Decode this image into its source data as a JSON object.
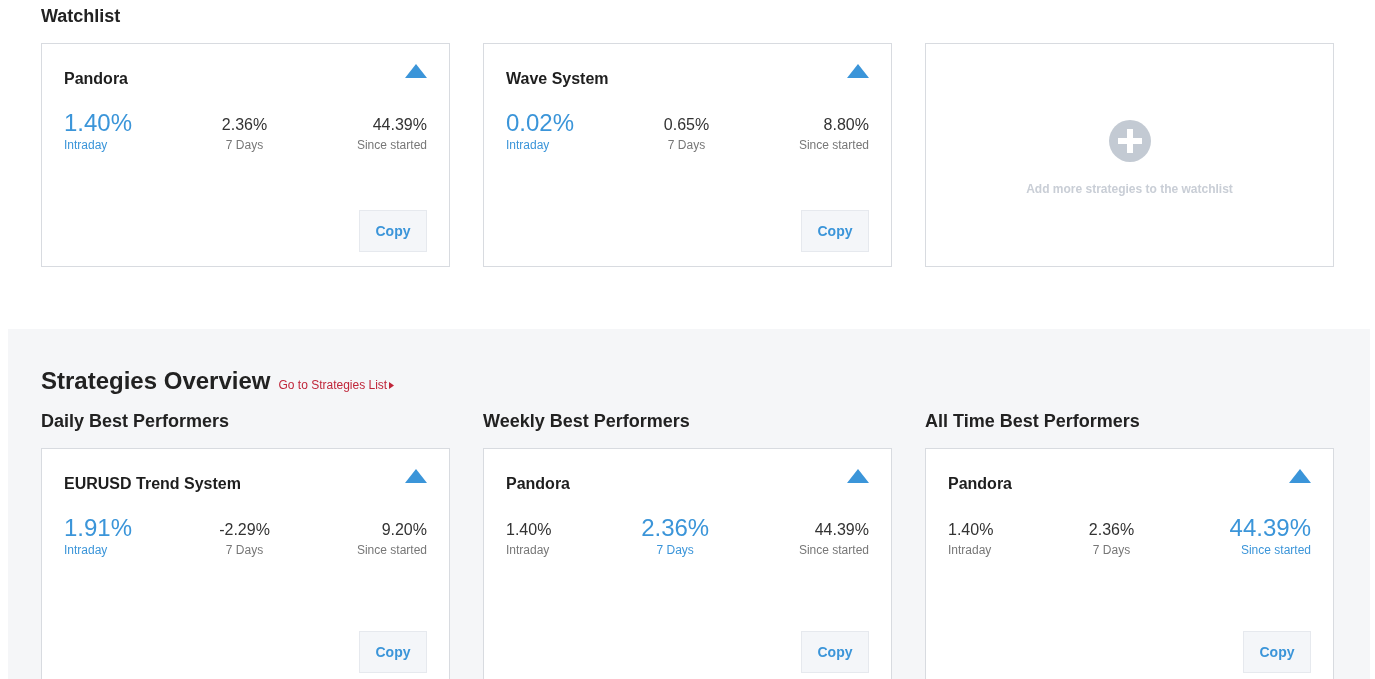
{
  "watchlist": {
    "title": "Watchlist",
    "cards": [
      {
        "name": "Pandora",
        "metrics": [
          {
            "value": "1.40%",
            "label": "Intraday",
            "highlight": true
          },
          {
            "value": "2.36%",
            "label": "7 Days",
            "highlight": false
          },
          {
            "value": "44.39%",
            "label": "Since started",
            "highlight": false
          }
        ],
        "button": "Copy"
      },
      {
        "name": "Wave System",
        "metrics": [
          {
            "value": "0.02%",
            "label": "Intraday",
            "highlight": true
          },
          {
            "value": "0.65%",
            "label": "7 Days",
            "highlight": false
          },
          {
            "value": "8.80%",
            "label": "Since started",
            "highlight": false
          }
        ],
        "button": "Copy"
      }
    ],
    "add_card": {
      "text": "Add more strategies to the watchlist"
    }
  },
  "overview": {
    "title": "Strategies Overview",
    "link": "Go to Strategies List",
    "columns": [
      {
        "heading": "Daily Best Performers",
        "card": {
          "name": "EURUSD Trend System",
          "metrics": [
            {
              "value": "1.91%",
              "label": "Intraday",
              "highlight": true
            },
            {
              "value": "-2.29%",
              "label": "7 Days",
              "highlight": false
            },
            {
              "value": "9.20%",
              "label": "Since started",
              "highlight": false
            }
          ],
          "button": "Copy"
        }
      },
      {
        "heading": "Weekly Best Performers",
        "card": {
          "name": "Pandora",
          "metrics": [
            {
              "value": "1.40%",
              "label": "Intraday",
              "highlight": false
            },
            {
              "value": "2.36%",
              "label": "7 Days",
              "highlight": true
            },
            {
              "value": "44.39%",
              "label": "Since started",
              "highlight": false
            }
          ],
          "button": "Copy"
        }
      },
      {
        "heading": "All Time Best Performers",
        "card": {
          "name": "Pandora",
          "metrics": [
            {
              "value": "1.40%",
              "label": "Intraday",
              "highlight": false
            },
            {
              "value": "2.36%",
              "label": "7 Days",
              "highlight": false
            },
            {
              "value": "44.39%",
              "label": "Since started",
              "highlight": true
            }
          ],
          "button": "Copy"
        }
      }
    ]
  }
}
